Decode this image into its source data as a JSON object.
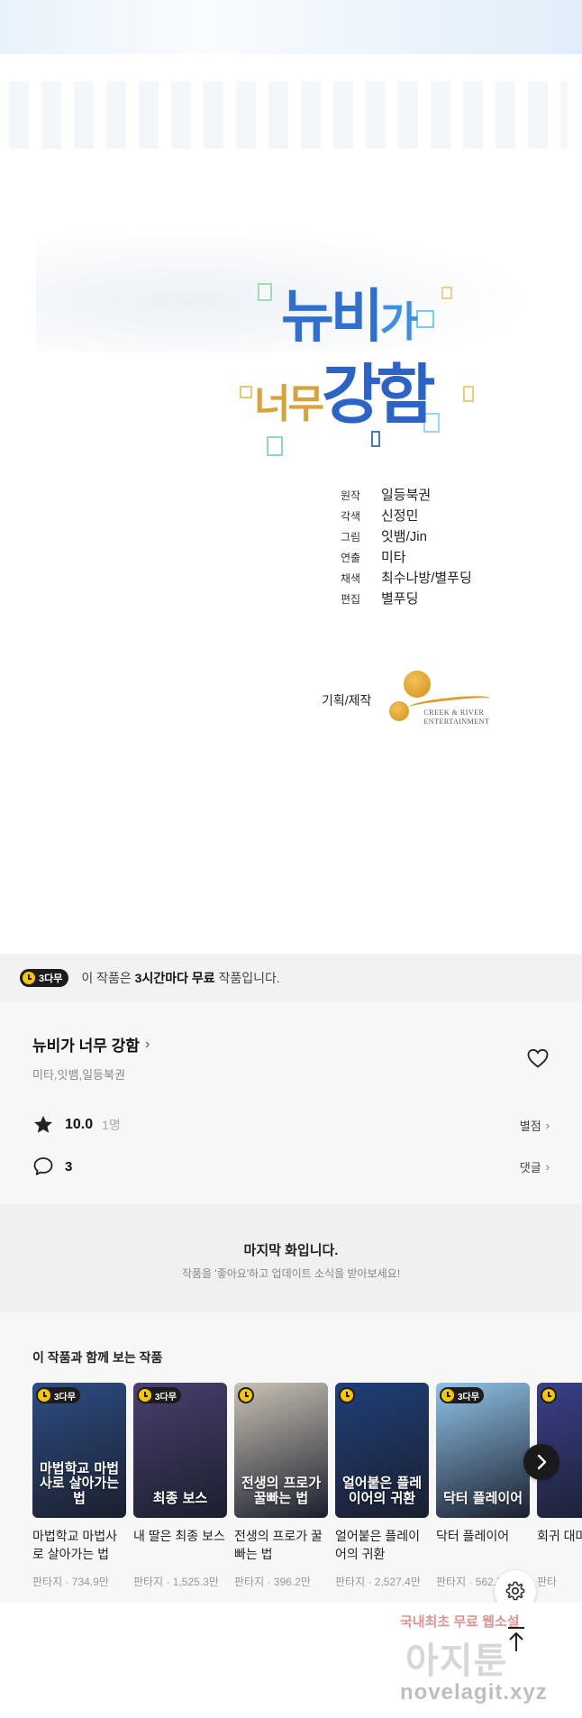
{
  "art": {
    "logo_line1_a": "뉴비",
    "logo_line1_b": "가",
    "logo_line2_a": "너무",
    "logo_line2_b": "강함",
    "credits": [
      {
        "role": "원작",
        "name": "일등북권"
      },
      {
        "role": "각색",
        "name": "신정민"
      },
      {
        "role": "그림",
        "name": "잇뱀/Jin"
      },
      {
        "role": "연출",
        "name": "미타"
      },
      {
        "role": "채색",
        "name": "최수나방/별푸딩"
      },
      {
        "role": "편집",
        "name": "별푸딩"
      }
    ],
    "production_label": "기획/제작",
    "company_line1": "CREEK & RIVER",
    "company_line2": "ENTERTAINMENT"
  },
  "free_banner": {
    "badge": "3다무",
    "text_before": "이 작품은 ",
    "text_bold": "3시간마다 무료",
    "text_after": " 작품입니다."
  },
  "series": {
    "title": "뉴비가 너무 강함",
    "authors": "미타,잇뱀,일등북권",
    "rating": "10.0",
    "raters": "1명",
    "rating_link": "별점",
    "comments": "3",
    "comments_link": "댓글"
  },
  "last_episode": {
    "title": "마지막 화입니다.",
    "subtitle": "작품을 '좋아요'하고 업데이트 소식을 받아보세요!"
  },
  "recommendations": {
    "heading": "이 작품과 함께 보는 작품",
    "items": [
      {
        "badge": "3다무",
        "cover_text": "마법학교 마법사로 살아가는 법",
        "title": "마법학교 마법사로 살아가는 법",
        "meta": "판타지 · 734.9만"
      },
      {
        "badge": "3다무",
        "cover_text": "최종 보스",
        "title": "내 딸은 최종 보스",
        "meta": "판타지 · 1,525.3만"
      },
      {
        "badge": "",
        "cover_text": "전생의 프로가 꿀빠는 법",
        "title": "전생의 프로가 꿀빠는 법",
        "meta": "판타지 · 396.2만"
      },
      {
        "badge": "",
        "cover_text": "얼어붙은 플레이어의 귀환",
        "title": "얼어붙은 플레이어의 귀환",
        "meta": "판타지 · 2,527.4만"
      },
      {
        "badge": "3다무",
        "cover_text": "닥터 플레이어",
        "title": "닥터 플레이어",
        "meta": "판타지 · 562.7만"
      },
      {
        "badge": "",
        "cover_text": "",
        "title": "회귀 대마",
        "meta": "판타"
      }
    ],
    "colors": [
      "#2d4d84",
      "#4a3f6e",
      "#c9c2b4",
      "#1f3f7a",
      "#8fc3e8",
      "#3a3f8a"
    ]
  },
  "watermark": {
    "line1": "국내최초 무료 웹소설",
    "line2": "아지툰",
    "line3": "novelagit.xyz"
  },
  "icons": {
    "heart": "heart-outline-icon",
    "star": "star-icon",
    "comment": "speech-bubble-icon",
    "next": "chevron-right-icon",
    "settings": "gear-icon",
    "top": "arrow-up-icon"
  }
}
